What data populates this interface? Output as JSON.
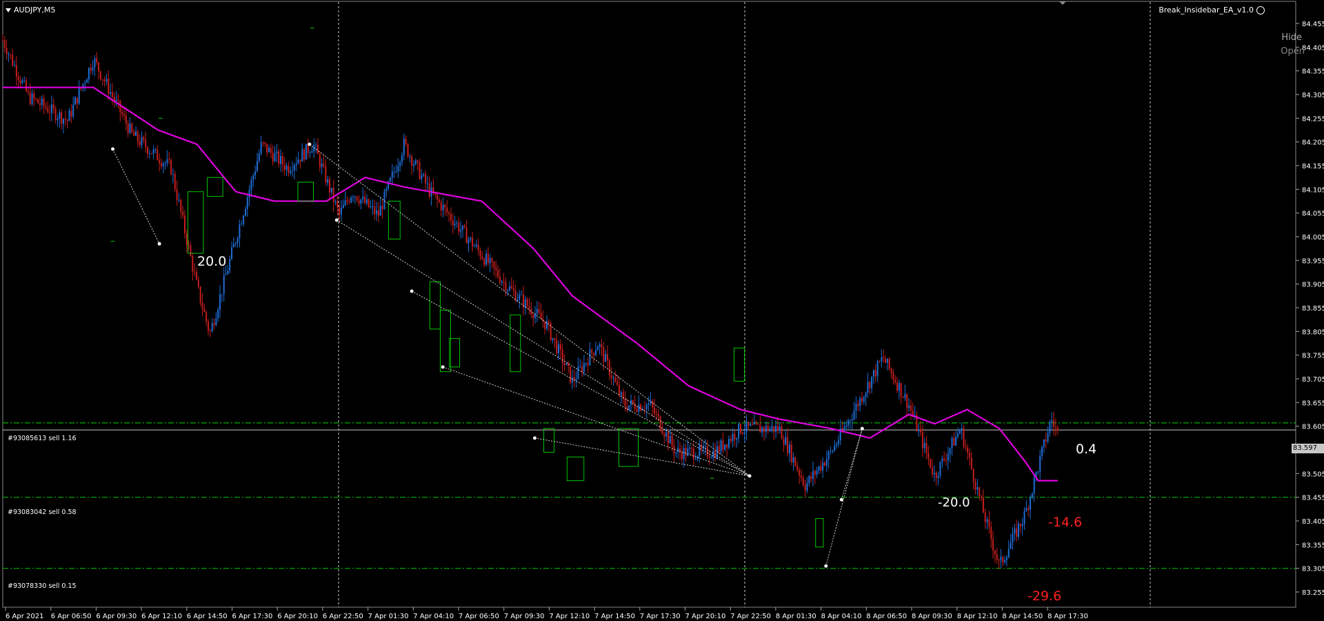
{
  "symbol": "AUDJPY,M5",
  "ea_name": "Break_Insidebar_EA_v1.0",
  "panel": {
    "hide_label": "Hide",
    "open_label": "Open"
  },
  "current_price": "83.597",
  "price_axis": {
    "ticks": [
      "84.455",
      "84.405",
      "84.355",
      "84.305",
      "84.255",
      "84.205",
      "84.155",
      "84.105",
      "84.055",
      "84.005",
      "83.955",
      "83.905",
      "83.855",
      "83.805",
      "83.755",
      "83.705",
      "83.655",
      "83.605",
      "83.555",
      "83.505",
      "83.455",
      "83.405",
      "83.355",
      "83.305",
      "83.255"
    ]
  },
  "time_axis": {
    "ticks": [
      "6 Apr 2021",
      "6 Apr 06:50",
      "6 Apr 09:30",
      "6 Apr 12:10",
      "6 Apr 14:50",
      "6 Apr 17:30",
      "6 Apr 20:10",
      "6 Apr 22:50",
      "7 Apr 01:30",
      "7 Apr 04:10",
      "7 Apr 06:50",
      "7 Apr 09:30",
      "7 Apr 12:10",
      "7 Apr 14:50",
      "7 Apr 17:30",
      "7 Apr 20:10",
      "7 Apr 22:50",
      "8 Apr 01:30",
      "8 Apr 04:10",
      "8 Apr 06:50",
      "8 Apr 09:30",
      "8 Apr 12:10",
      "8 Apr 14:50",
      "8 Apr 17:30"
    ]
  },
  "orders": [
    {
      "label": "#93085613 sell 1.16",
      "price": 83.612
    },
    {
      "label": "#93083042 sell 0.58",
      "price": 83.455
    },
    {
      "label": "#93078330 sell 0.15",
      "price": 83.305
    }
  ],
  "profit_labels": [
    {
      "text": "20.0",
      "color": "#ffffff"
    },
    {
      "text": "0.4",
      "color": "#ffffff"
    },
    {
      "text": "-14.6",
      "color": "#ff2020"
    },
    {
      "text": "-29.6",
      "color": "#ff2020"
    },
    {
      "text": "-20.0",
      "color": "#ffffff"
    }
  ],
  "colors": {
    "background": "#000000",
    "bull_candle": "#1e6fd9",
    "bear_candle": "#c81e1e",
    "moving_average": "#e000e0",
    "order_line": "#00b400",
    "insidebar_box": "#00c800",
    "trade_line": "#d8d8d8"
  },
  "chart_data": {
    "type": "candlestick",
    "ylim": [
      83.23,
      84.48
    ],
    "grid": "vertical day separators",
    "price_path": [
      [
        0,
        84.42
      ],
      [
        0.02,
        84.3
      ],
      [
        0.05,
        84.25
      ],
      [
        0.07,
        84.38
      ],
      [
        0.1,
        84.22
      ],
      [
        0.13,
        84.15
      ],
      [
        0.15,
        83.9
      ],
      [
        0.16,
        83.8
      ],
      [
        0.18,
        84.0
      ],
      [
        0.2,
        84.2
      ],
      [
        0.22,
        84.15
      ],
      [
        0.24,
        84.2
      ],
      [
        0.26,
        84.05
      ],
      [
        0.27,
        84.1
      ],
      [
        0.29,
        84.05
      ],
      [
        0.31,
        84.2
      ],
      [
        0.33,
        84.1
      ],
      [
        0.36,
        84.0
      ],
      [
        0.39,
        83.9
      ],
      [
        0.42,
        83.82
      ],
      [
        0.44,
        83.7
      ],
      [
        0.46,
        83.78
      ],
      [
        0.48,
        83.65
      ],
      [
        0.5,
        83.65
      ],
      [
        0.52,
        83.55
      ],
      [
        0.55,
        83.55
      ],
      [
        0.57,
        83.6
      ],
      [
        0.6,
        83.6
      ],
      [
        0.62,
        83.48
      ],
      [
        0.64,
        83.55
      ],
      [
        0.66,
        83.65
      ],
      [
        0.68,
        83.75
      ],
      [
        0.7,
        83.65
      ],
      [
        0.72,
        83.5
      ],
      [
        0.74,
        83.6
      ],
      [
        0.76,
        83.4
      ],
      [
        0.77,
        83.31
      ],
      [
        0.79,
        83.42
      ],
      [
        0.81,
        83.62
      ],
      [
        0.815,
        83.59
      ]
    ],
    "moving_average": [
      [
        0,
        84.32
      ],
      [
        0.07,
        84.32
      ],
      [
        0.12,
        84.23
      ],
      [
        0.15,
        84.2
      ],
      [
        0.18,
        84.1
      ],
      [
        0.21,
        84.08
      ],
      [
        0.25,
        84.08
      ],
      [
        0.28,
        84.13
      ],
      [
        0.31,
        84.11
      ],
      [
        0.37,
        84.08
      ],
      [
        0.41,
        83.98
      ],
      [
        0.44,
        83.88
      ],
      [
        0.49,
        83.78
      ],
      [
        0.53,
        83.69
      ],
      [
        0.57,
        83.64
      ],
      [
        0.6,
        83.62
      ],
      [
        0.64,
        83.6
      ],
      [
        0.67,
        83.58
      ],
      [
        0.7,
        83.63
      ],
      [
        0.72,
        83.61
      ],
      [
        0.745,
        83.64
      ],
      [
        0.77,
        83.6
      ],
      [
        0.79,
        83.53
      ],
      [
        0.8,
        83.49
      ],
      [
        0.815,
        83.49
      ]
    ]
  }
}
